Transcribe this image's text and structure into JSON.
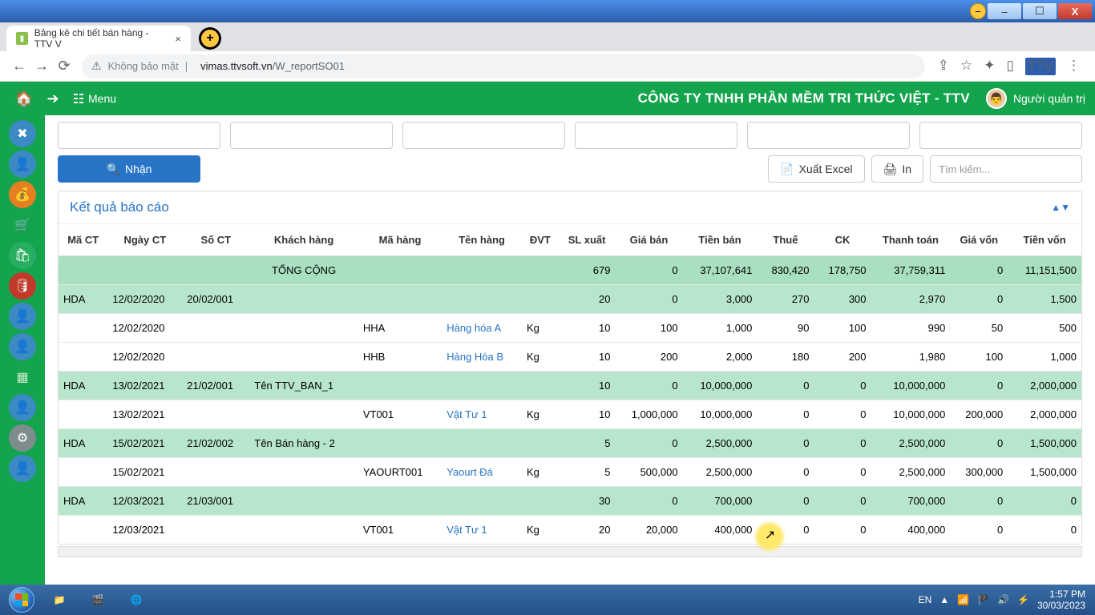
{
  "win": {
    "min": "–",
    "max": "☐",
    "close": "X"
  },
  "browser": {
    "tab_title": "Bảng kê chi tiết bán hàng - TTV V",
    "url_prefix": "Không bảo mật",
    "url_host": "vimas.ttvsoft.vn",
    "url_path": "/W_reportSO01"
  },
  "header": {
    "menu_label": "Menu",
    "company": "CÔNG TY TNHH PHẦN MỀM TRI THỨC VIỆT - TTV",
    "user": "Người quản trị"
  },
  "actions": {
    "nhan": "Nhận",
    "excel": "Xuất Excel",
    "print": "In",
    "search_placeholder": "Tìm kiếm..."
  },
  "panel_title": "Kết quả báo cáo",
  "columns": [
    "Mã CT",
    "Ngày CT",
    "Số CT",
    "Khách hàng",
    "Mã hàng",
    "Tên hàng",
    "ĐVT",
    "SL xuất",
    "Giá bán",
    "Tiền bán",
    "Thuế",
    "CK",
    "Thanh toán",
    "Giá vốn",
    "Tiền vốn"
  ],
  "rows": [
    {
      "cls": "grn",
      "c": [
        "",
        "",
        "",
        "TỔNG CỘNG",
        "",
        "",
        "",
        "679",
        "0",
        "37,107,641",
        "830,420",
        "178,750",
        "37,759,311",
        "0",
        "11,151,500"
      ]
    },
    {
      "cls": "grn2",
      "c": [
        "HDA",
        "12/02/2020",
        "20/02/001",
        "",
        "",
        "",
        "",
        "20",
        "0",
        "3,000",
        "270",
        "300",
        "2,970",
        "0",
        "1,500"
      ]
    },
    {
      "cls": "",
      "c": [
        "",
        "12/02/2020",
        "",
        "",
        "HHA",
        "Hàng hóa A",
        "Kg",
        "10",
        "100",
        "1,000",
        "90",
        "100",
        "990",
        "50",
        "500"
      ],
      "link": 5
    },
    {
      "cls": "",
      "c": [
        "",
        "12/02/2020",
        "",
        "",
        "HHB",
        "Hàng Hóa B",
        "Kg",
        "10",
        "200",
        "2,000",
        "180",
        "200",
        "1,980",
        "100",
        "1,000"
      ],
      "link": 5
    },
    {
      "cls": "grn2",
      "c": [
        "HDA",
        "13/02/2021",
        "21/02/001",
        "Tên TTV_BAN_1",
        "",
        "",
        "",
        "10",
        "0",
        "10,000,000",
        "0",
        "0",
        "10,000,000",
        "0",
        "2,000,000"
      ]
    },
    {
      "cls": "",
      "c": [
        "",
        "13/02/2021",
        "",
        "",
        "VT001",
        "Vật Tư 1",
        "Kg",
        "10",
        "1,000,000",
        "10,000,000",
        "0",
        "0",
        "10,000,000",
        "200,000",
        "2,000,000"
      ],
      "link": 5
    },
    {
      "cls": "grn2",
      "c": [
        "HDA",
        "15/02/2021",
        "21/02/002",
        "Tên Bán hàng - 2",
        "",
        "",
        "",
        "5",
        "0",
        "2,500,000",
        "0",
        "0",
        "2,500,000",
        "0",
        "1,500,000"
      ]
    },
    {
      "cls": "",
      "c": [
        "",
        "15/02/2021",
        "",
        "",
        "YAOURT001",
        "Yaourt Đá",
        "Kg",
        "5",
        "500,000",
        "2,500,000",
        "0",
        "0",
        "2,500,000",
        "300,000",
        "1,500,000"
      ],
      "link": 5
    },
    {
      "cls": "grn2",
      "c": [
        "HDA",
        "12/03/2021",
        "21/03/001",
        "",
        "",
        "",
        "",
        "30",
        "0",
        "700,000",
        "0",
        "0",
        "700,000",
        "0",
        "0"
      ]
    },
    {
      "cls": "",
      "c": [
        "",
        "12/03/2021",
        "",
        "",
        "VT001",
        "Vật Tư 1",
        "Kg",
        "20",
        "20,000",
        "400,000",
        "0",
        "0",
        "400,000",
        "0",
        "0"
      ],
      "link": 5
    }
  ],
  "tray": {
    "lang": "EN",
    "time": "1:57 PM",
    "date": "30/03/2023"
  }
}
